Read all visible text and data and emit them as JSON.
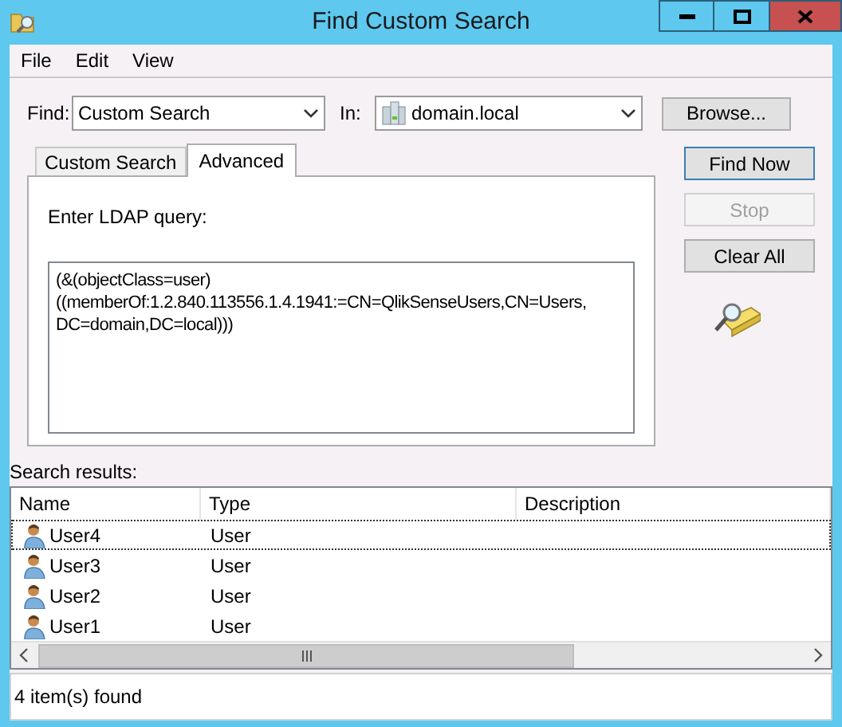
{
  "window": {
    "title": "Find Custom Search"
  },
  "menu": [
    "File",
    "Edit",
    "View"
  ],
  "find": {
    "label": "Find:",
    "value": "Custom Search"
  },
  "in": {
    "label": "In:",
    "value": "domain.local"
  },
  "browse_button": "Browse...",
  "tabs": [
    {
      "label": "Custom Search",
      "selected": false
    },
    {
      "label": "Advanced",
      "selected": true
    }
  ],
  "query": {
    "label": "Enter LDAP query:",
    "value": "(&(objectClass=user)\n((memberOf:1.2.840.113556.1.4.1941:=CN=QlikSenseUsers,CN=Users,\nDC=domain,DC=local)))"
  },
  "buttons": [
    {
      "label": "Find Now",
      "disabled": false,
      "default": true
    },
    {
      "label": "Stop",
      "disabled": true,
      "default": false
    },
    {
      "label": "Clear All",
      "disabled": false,
      "default": false
    }
  ],
  "results_label": "Search results:",
  "table": {
    "columns": [
      "Name",
      "Type",
      "Description"
    ],
    "rows": [
      {
        "name": "User4",
        "type": "User",
        "focused": true
      },
      {
        "name": "User3",
        "type": "User",
        "focused": false
      },
      {
        "name": "User2",
        "type": "User",
        "focused": false
      },
      {
        "name": "User1",
        "type": "User",
        "focused": false
      }
    ]
  },
  "status_bar": "4 item(s) found"
}
